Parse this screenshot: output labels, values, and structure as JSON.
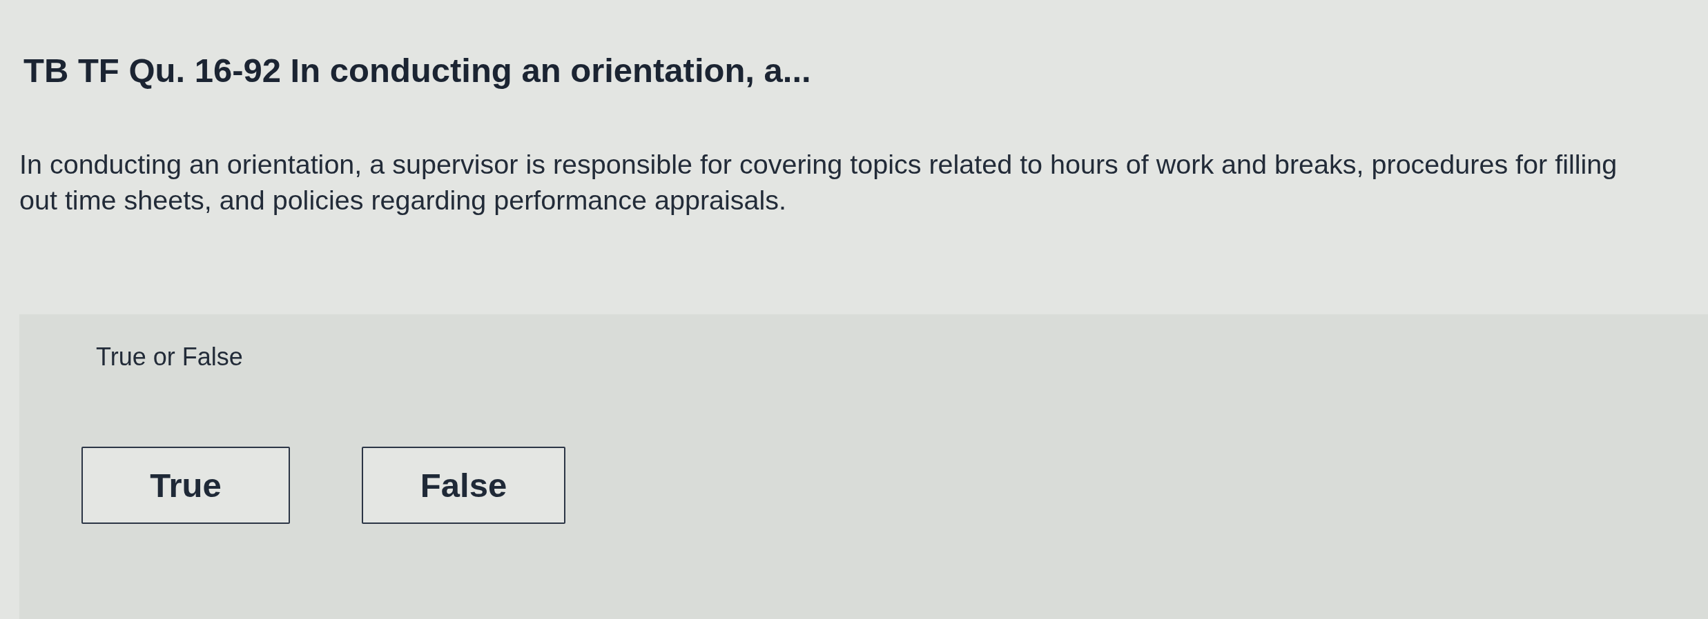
{
  "question": {
    "title": "TB TF Qu. 16-92 In conducting an orientation, a...",
    "text": "In conducting an orientation, a supervisor is responsible for covering topics related to hours of work and breaks, procedures for filling out time sheets, and policies regarding performance appraisals."
  },
  "answer_panel": {
    "prompt": "True or False",
    "options": [
      {
        "label": "True",
        "selected": false
      },
      {
        "label": "False",
        "selected": false
      }
    ]
  }
}
